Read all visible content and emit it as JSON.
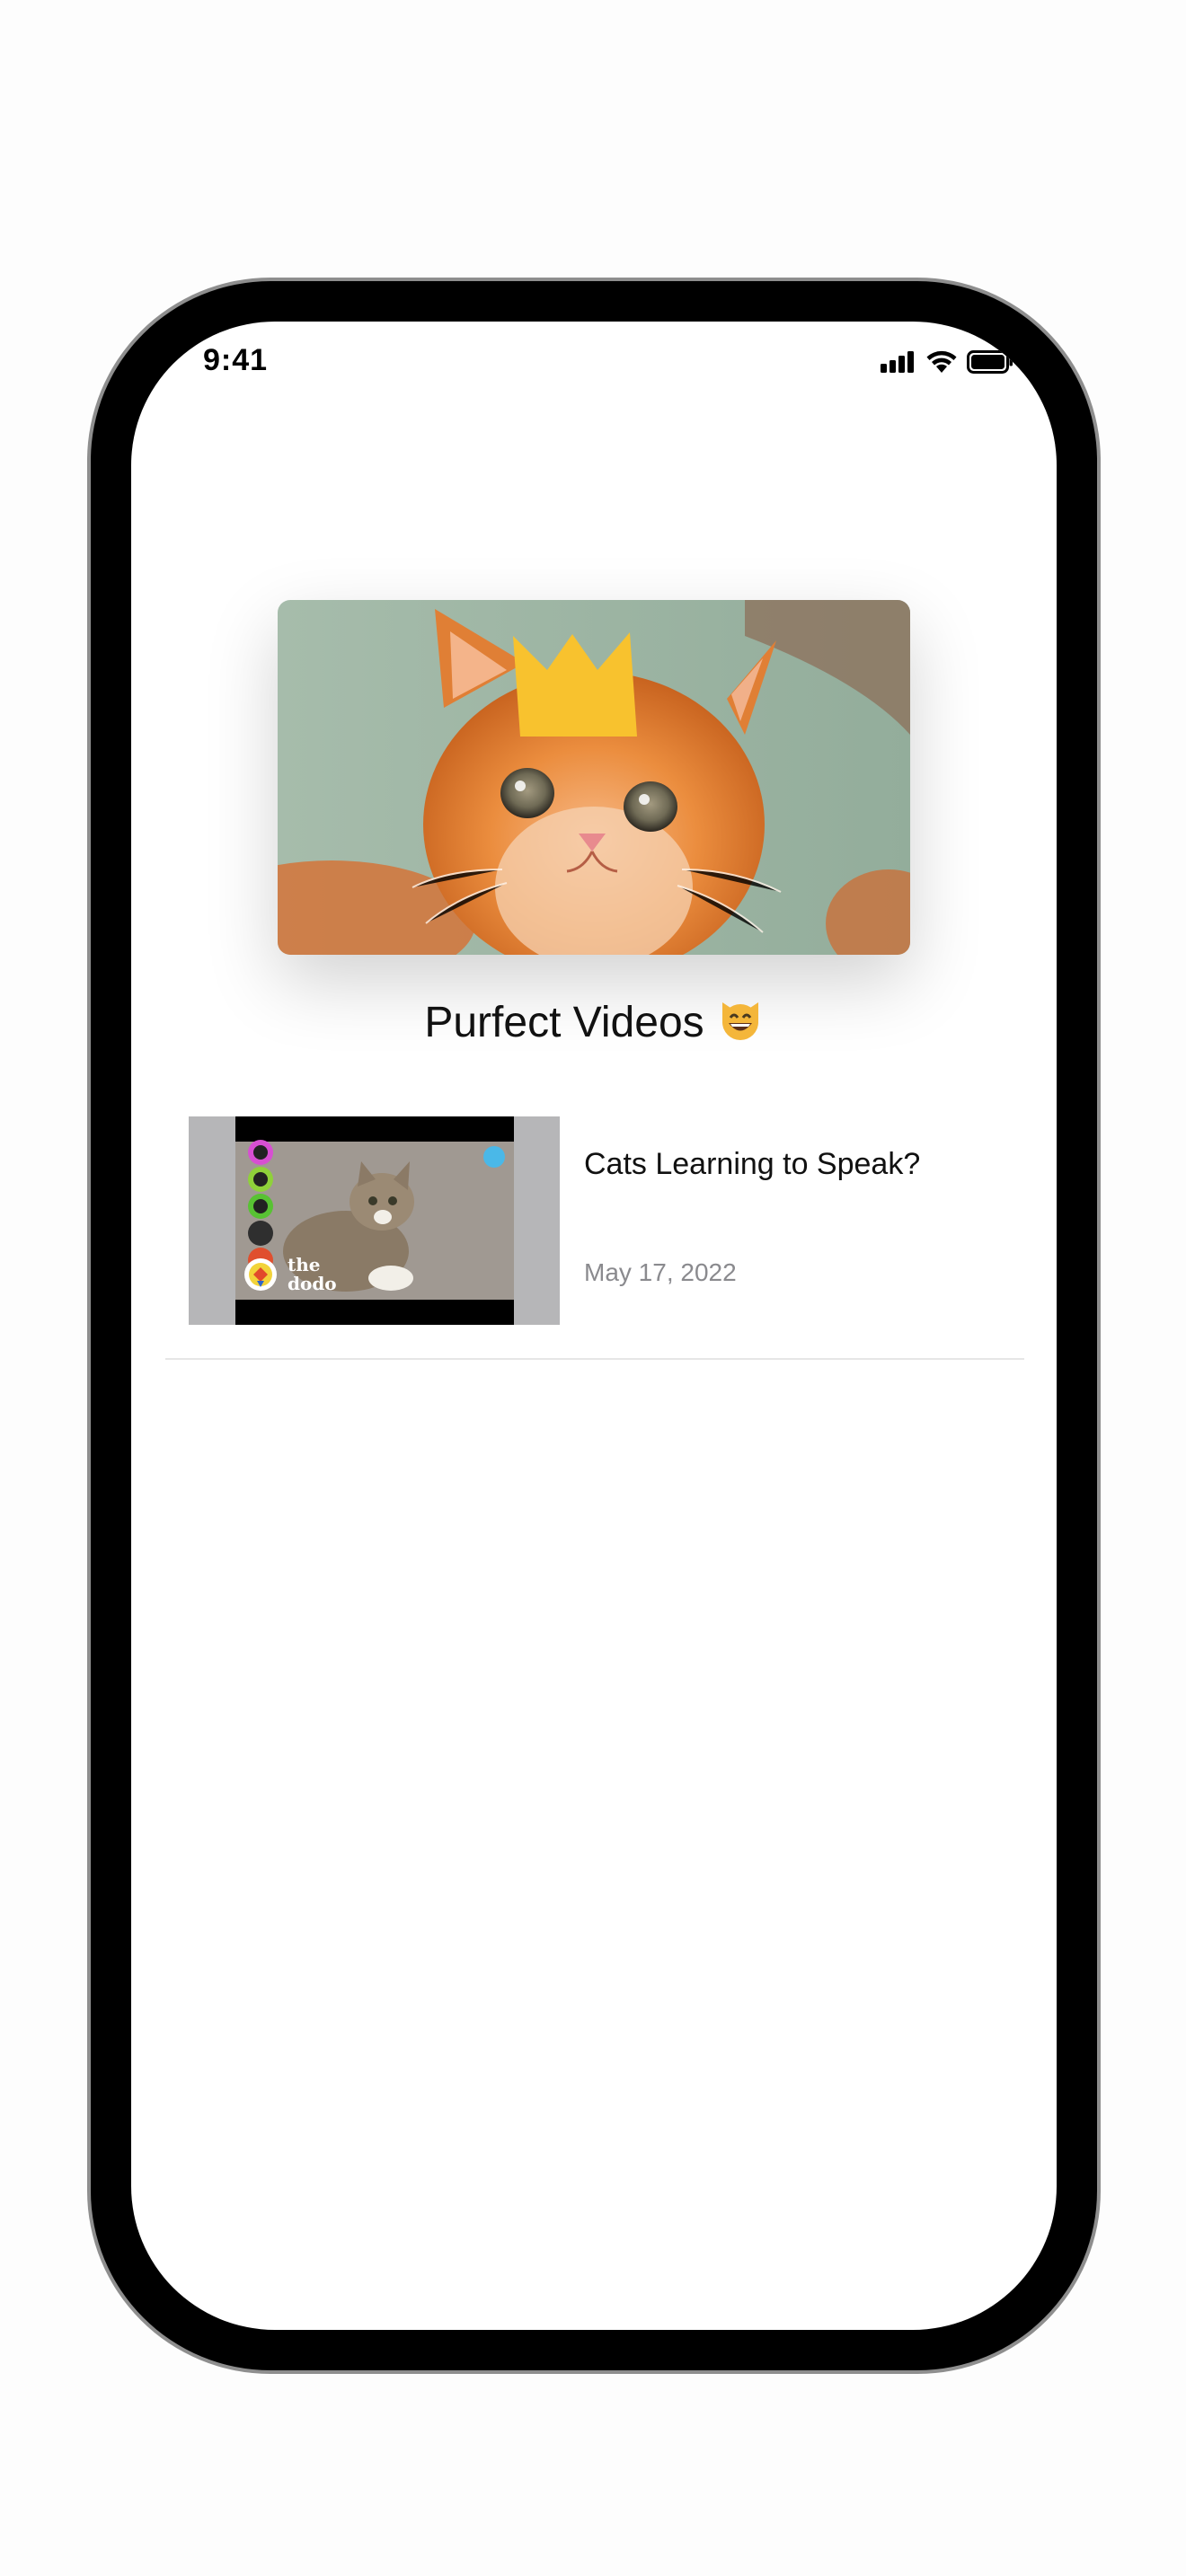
{
  "status_bar": {
    "time": "9:41"
  },
  "header": {
    "title": "Purfect Videos",
    "title_emoji": "😸",
    "hero_image": "kitten-with-crown"
  },
  "videos": [
    {
      "title": "Cats Learning to Speak?",
      "date": "May 17, 2022",
      "thumbnail": "cat-with-buttons",
      "thumbnail_logo": "the dodo"
    }
  ],
  "colors": {
    "crown": "#f8c22e",
    "kitten": "#e98a3a",
    "background_green": "#9fb5a4",
    "thumbnail_pillarbox": "#b6b6b8",
    "date_text": "#8a8a8e"
  }
}
